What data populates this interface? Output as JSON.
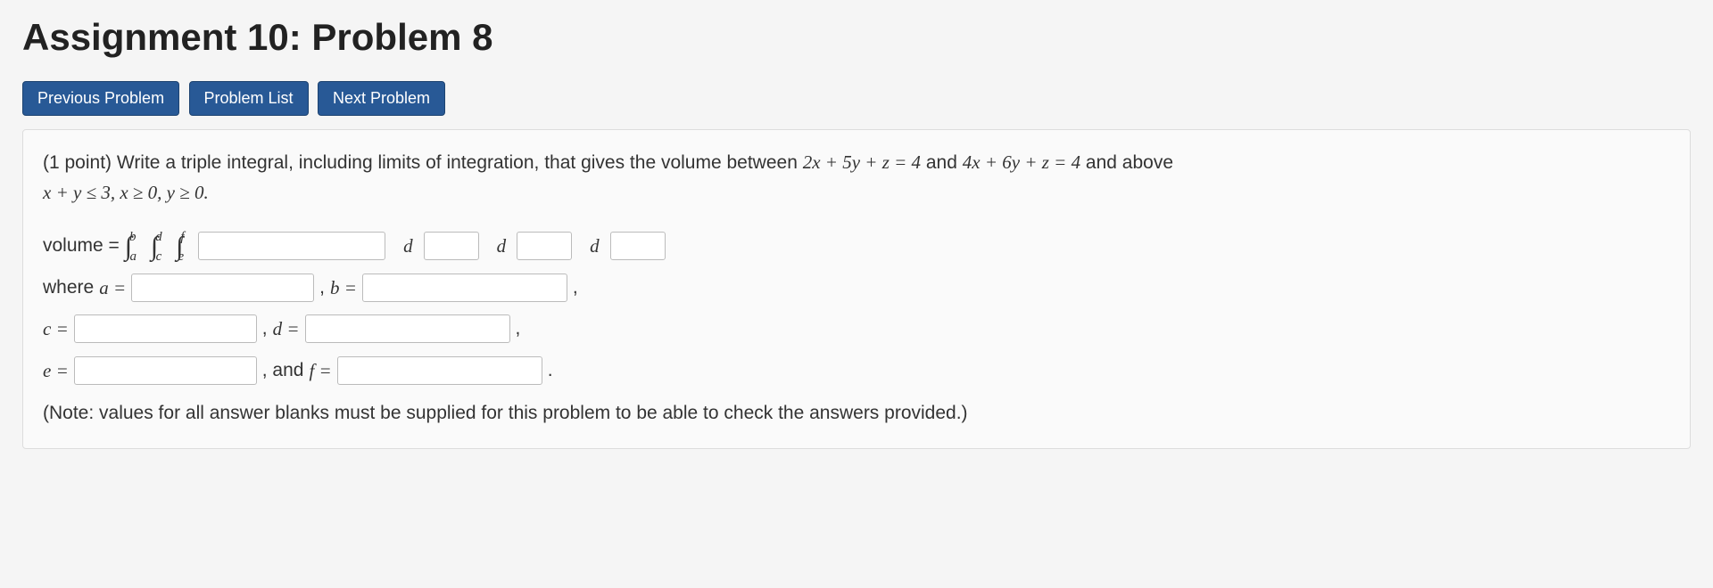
{
  "heading": "Assignment 10: Problem 8",
  "nav": {
    "prev": "Previous Problem",
    "list": "Problem List",
    "next": "Next Problem"
  },
  "problem": {
    "points_prefix": "(1 point) ",
    "prompt_part1": "Write a triple integral, including limits of integration, that gives the volume between ",
    "eq1": "2x + 5y + z = 4",
    "between_and": " and ",
    "eq2": "4x + 6y + z = 4",
    "prompt_part2": " and above ",
    "region": "x + y ≤ 3, x ≥ 0, y ≥ 0."
  },
  "volume_row": {
    "label": "volume = ",
    "int1_low": "a",
    "int1_up": "b",
    "int2_low": "c",
    "int2_up": "d",
    "int3_low": "e",
    "int3_up": "f",
    "d_label": "d"
  },
  "limits": {
    "where": "where ",
    "a_eq": "a = ",
    "comma_b": " , ",
    "b_eq": "b = ",
    "c_eq": "c = ",
    "comma_d": " , ",
    "d_eq": "d = ",
    "e_eq": "e = ",
    "and_f": " , and ",
    "f_eq": "f = ",
    "trailing_comma1": " ,",
    "trailing_comma2": " ,",
    "trailing_dot": " ."
  },
  "note": "(Note: values for all answer blanks must be supplied for this problem to be able to check the answers provided.)"
}
